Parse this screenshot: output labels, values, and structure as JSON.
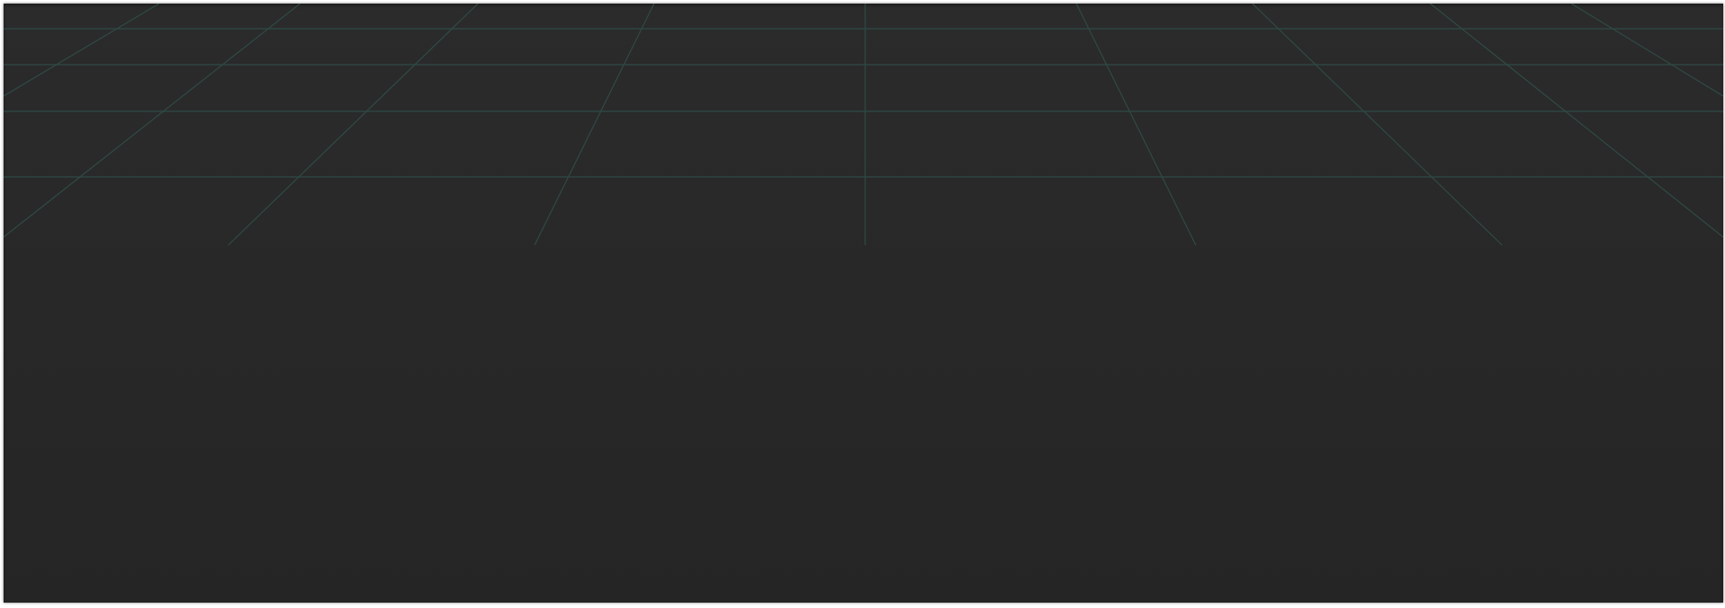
{
  "scene": {
    "background_top": "#2b2b2b",
    "background_bottom": "#252525",
    "grid_color": "#2f4a46",
    "grid_visible": true
  }
}
